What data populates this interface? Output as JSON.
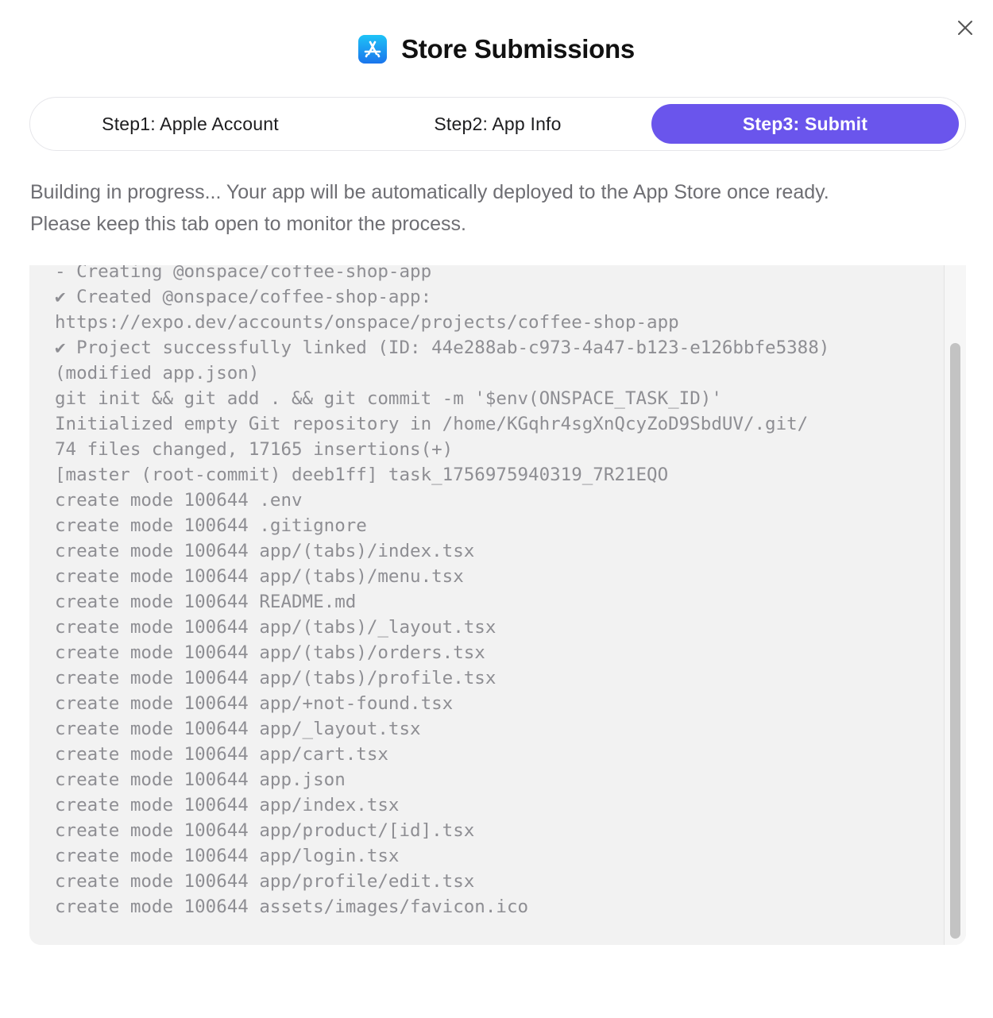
{
  "dialog": {
    "title": "Store Submissions",
    "app_icon": "app-store-icon",
    "close_icon": "close-icon"
  },
  "steps": [
    {
      "label": "Step1: Apple Account",
      "active": false
    },
    {
      "label": "Step2: App Info",
      "active": false
    },
    {
      "label": "Step3: Submit",
      "active": true
    }
  ],
  "description": {
    "line1": "Building in progress... Your app will be automatically deployed to the App Store once ready.",
    "line2": "Please keep this tab open to monitor the process."
  },
  "colors": {
    "accent": "#6a55ec",
    "log_background": "#f2f2f2",
    "log_text": "#8e8e93"
  },
  "log": {
    "lines": [
      "- Creating @onspace/coffee-shop-app",
      "✔ Created @onspace/coffee-shop-app:",
      "https://expo.dev/accounts/onspace/projects/coffee-shop-app",
      "✔ Project successfully linked (ID: 44e288ab-c973-4a47-b123-e126bbfe5388)",
      "(modified app.json)",
      "git init && git add . && git commit -m '$env(ONSPACE_TASK_ID)'",
      "Initialized empty Git repository in /home/KGqhr4sgXnQcyZoD9SbdUV/.git/",
      "74 files changed, 17165 insertions(+)",
      "[master (root-commit) deeb1ff] task_1756975940319_7R21EQO",
      "create mode 100644 .env",
      "create mode 100644 .gitignore",
      "create mode 100644 app/(tabs)/index.tsx",
      "create mode 100644 app/(tabs)/menu.tsx",
      "create mode 100644 README.md",
      "create mode 100644 app/(tabs)/_layout.tsx",
      "create mode 100644 app/(tabs)/orders.tsx",
      "create mode 100644 app/(tabs)/profile.tsx",
      "create mode 100644 app/+not-found.tsx",
      "create mode 100644 app/_layout.tsx",
      "create mode 100644 app/cart.tsx",
      "create mode 100644 app.json",
      "create mode 100644 app/index.tsx",
      "create mode 100644 app/product/[id].tsx",
      "create mode 100644 app/login.tsx",
      "create mode 100644 app/profile/edit.tsx",
      "create mode 100644 assets/images/favicon.ico"
    ]
  }
}
